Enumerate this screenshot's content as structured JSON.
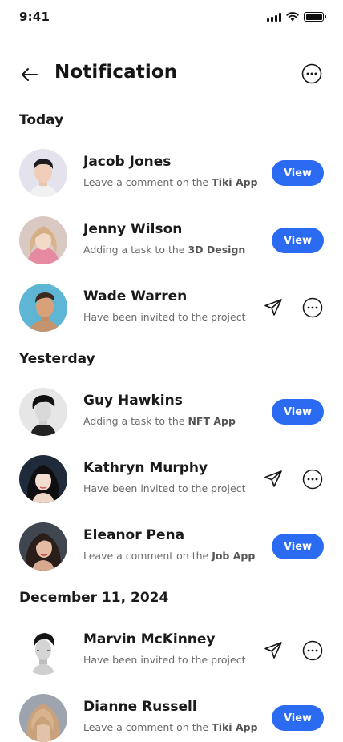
{
  "status_bar": {
    "time": "9:41"
  },
  "header": {
    "title": "Notification"
  },
  "sections": [
    {
      "title": "Today"
    },
    {
      "title": "Yesterday"
    },
    {
      "title": "December 11, 2024"
    }
  ],
  "notifications": [
    {
      "name": "Jacob Jones",
      "text": "Leave a comment on the ",
      "highlight": "Tiki App",
      "action": "View"
    },
    {
      "name": "Jenny Wilson",
      "text": "Adding a task to the ",
      "highlight": "3D Design",
      "action": "View"
    },
    {
      "name": "Wade Warren",
      "text": "Have been invited to the project",
      "highlight": "",
      "action": ""
    },
    {
      "name": "Guy Hawkins",
      "text": "Adding a task to the ",
      "highlight": "NFT App",
      "action": "View"
    },
    {
      "name": "Kathryn Murphy",
      "text": "Have been invited to the project",
      "highlight": "",
      "action": ""
    },
    {
      "name": "Eleanor Pena",
      "text": "Leave a comment on the ",
      "highlight": "Job App",
      "action": "View"
    },
    {
      "name": "Marvin McKinney",
      "text": "Have been invited to the project",
      "highlight": "",
      "action": ""
    },
    {
      "name": "Dianne Russell",
      "text": "Leave a comment on the ",
      "highlight": "Tiki App",
      "action": "View"
    }
  ],
  "colors": {
    "accent": "#2a6bf2",
    "text": "#1a1a1a",
    "muted": "#6a6a6a"
  }
}
